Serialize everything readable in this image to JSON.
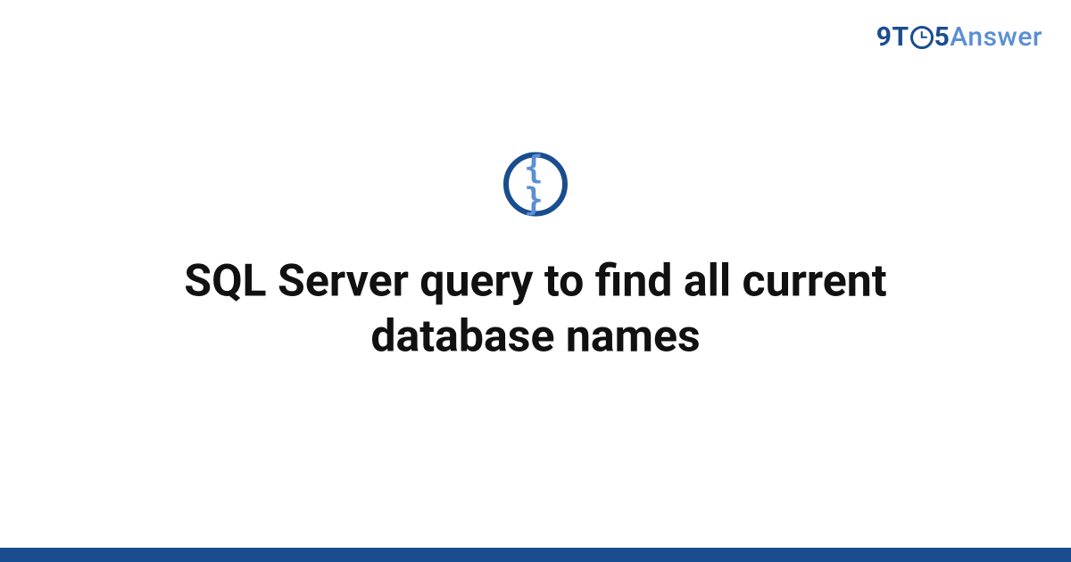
{
  "brand": {
    "part_nine": "9",
    "part_t": "T",
    "part_five": "5",
    "part_answer": "Answer"
  },
  "icon": {
    "name": "code-braces-icon",
    "glyph": "{ }"
  },
  "title": "SQL Server query to find all current database names",
  "colors": {
    "brand_dark": "#1a4d8f",
    "brand_light": "#5a8fd4",
    "text": "#111111",
    "background": "#ffffff"
  }
}
